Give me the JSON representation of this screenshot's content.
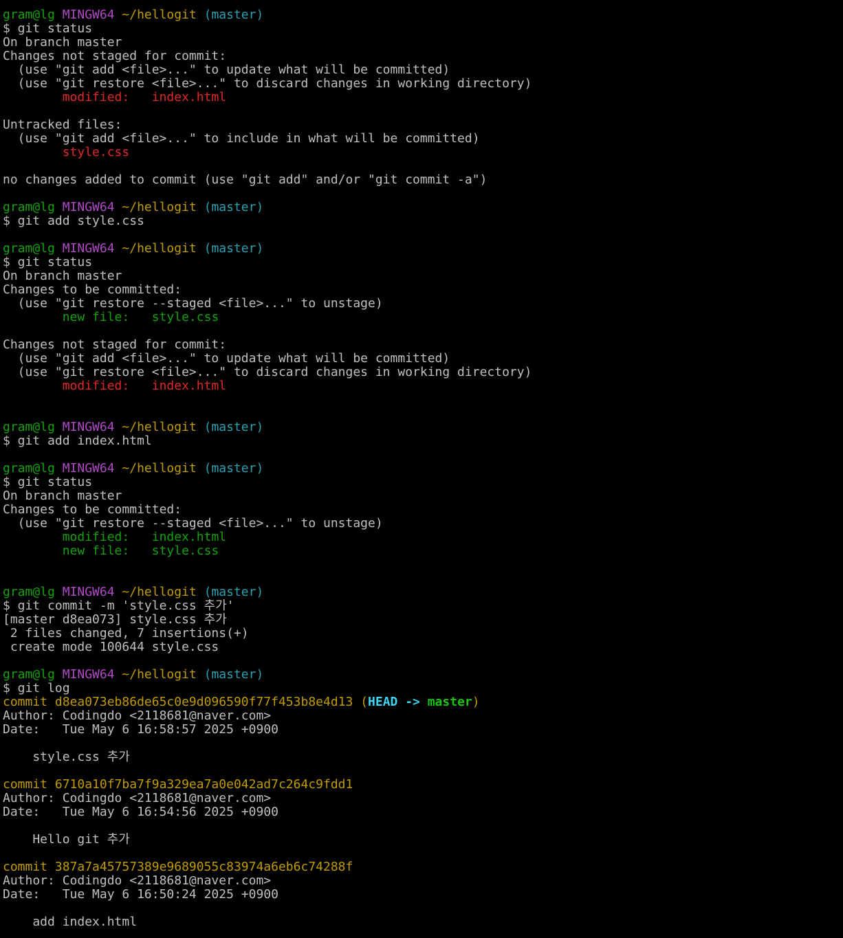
{
  "colors": {
    "background": "#000000",
    "default": "#c0c0c0",
    "green": "#13a10e",
    "magenta": "#b148c6",
    "yellow": "#c19c00",
    "cyan": "#2aa1b3",
    "red": "#e02828",
    "bright_cyan": "#3bd6ef",
    "bright_green": "#16c60c"
  },
  "lines": [
    [
      {
        "t": "gram@lg ",
        "c": "green"
      },
      {
        "t": "MINGW64 ",
        "c": "magenta"
      },
      {
        "t": "~/hellogit ",
        "c": "yellow"
      },
      {
        "t": "(master)",
        "c": "cyan"
      }
    ],
    [
      {
        "t": "$ git status",
        "c": "default"
      }
    ],
    [
      {
        "t": "On branch master",
        "c": "default"
      }
    ],
    [
      {
        "t": "Changes not staged for commit:",
        "c": "default"
      }
    ],
    [
      {
        "t": "  (use \"git add <file>...\" to update what will be committed)",
        "c": "default"
      }
    ],
    [
      {
        "t": "  (use \"git restore <file>...\" to discard changes in working directory)",
        "c": "default"
      }
    ],
    [
      {
        "t": "        ",
        "c": "default"
      },
      {
        "t": "modified:   index.html",
        "c": "red"
      }
    ],
    [],
    [
      {
        "t": "Untracked files:",
        "c": "default"
      }
    ],
    [
      {
        "t": "  (use \"git add <file>...\" to include in what will be committed)",
        "c": "default"
      }
    ],
    [
      {
        "t": "        ",
        "c": "default"
      },
      {
        "t": "style.css",
        "c": "red"
      }
    ],
    [],
    [
      {
        "t": "no changes added to commit (use \"git add\" and/or \"git commit -a\")",
        "c": "default"
      }
    ],
    [],
    [
      {
        "t": "gram@lg ",
        "c": "green"
      },
      {
        "t": "MINGW64 ",
        "c": "magenta"
      },
      {
        "t": "~/hellogit ",
        "c": "yellow"
      },
      {
        "t": "(master)",
        "c": "cyan"
      }
    ],
    [
      {
        "t": "$ git add style.css",
        "c": "default"
      }
    ],
    [],
    [
      {
        "t": "gram@lg ",
        "c": "green"
      },
      {
        "t": "MINGW64 ",
        "c": "magenta"
      },
      {
        "t": "~/hellogit ",
        "c": "yellow"
      },
      {
        "t": "(master)",
        "c": "cyan"
      }
    ],
    [
      {
        "t": "$ git status",
        "c": "default"
      }
    ],
    [
      {
        "t": "On branch master",
        "c": "default"
      }
    ],
    [
      {
        "t": "Changes to be committed:",
        "c": "default"
      }
    ],
    [
      {
        "t": "  (use \"git restore --staged <file>...\" to unstage)",
        "c": "default"
      }
    ],
    [
      {
        "t": "        ",
        "c": "default"
      },
      {
        "t": "new file:   style.css",
        "c": "green"
      }
    ],
    [],
    [
      {
        "t": "Changes not staged for commit:",
        "c": "default"
      }
    ],
    [
      {
        "t": "  (use \"git add <file>...\" to update what will be committed)",
        "c": "default"
      }
    ],
    [
      {
        "t": "  (use \"git restore <file>...\" to discard changes in working directory)",
        "c": "default"
      }
    ],
    [
      {
        "t": "        ",
        "c": "default"
      },
      {
        "t": "modified:   index.html",
        "c": "red"
      }
    ],
    [],
    [],
    [
      {
        "t": "gram@lg ",
        "c": "green"
      },
      {
        "t": "MINGW64 ",
        "c": "magenta"
      },
      {
        "t": "~/hellogit ",
        "c": "yellow"
      },
      {
        "t": "(master)",
        "c": "cyan"
      }
    ],
    [
      {
        "t": "$ git add index.html",
        "c": "default"
      }
    ],
    [],
    [
      {
        "t": "gram@lg ",
        "c": "green"
      },
      {
        "t": "MINGW64 ",
        "c": "magenta"
      },
      {
        "t": "~/hellogit ",
        "c": "yellow"
      },
      {
        "t": "(master)",
        "c": "cyan"
      }
    ],
    [
      {
        "t": "$ git status",
        "c": "default"
      }
    ],
    [
      {
        "t": "On branch master",
        "c": "default"
      }
    ],
    [
      {
        "t": "Changes to be committed:",
        "c": "default"
      }
    ],
    [
      {
        "t": "  (use \"git restore --staged <file>...\" to unstage)",
        "c": "default"
      }
    ],
    [
      {
        "t": "        ",
        "c": "default"
      },
      {
        "t": "modified:   index.html",
        "c": "green"
      }
    ],
    [
      {
        "t": "        ",
        "c": "default"
      },
      {
        "t": "new file:   style.css",
        "c": "green"
      }
    ],
    [],
    [],
    [
      {
        "t": "gram@lg ",
        "c": "green"
      },
      {
        "t": "MINGW64 ",
        "c": "magenta"
      },
      {
        "t": "~/hellogit ",
        "c": "yellow"
      },
      {
        "t": "(master)",
        "c": "cyan"
      }
    ],
    [
      {
        "t": "$ git commit -m 'style.css 추가'",
        "c": "default"
      }
    ],
    [
      {
        "t": "[master d8ea073] style.css 추가",
        "c": "default"
      }
    ],
    [
      {
        "t": " 2 files changed, 7 insertions(+)",
        "c": "default"
      }
    ],
    [
      {
        "t": " create mode 100644 style.css",
        "c": "default"
      }
    ],
    [],
    [
      {
        "t": "gram@lg ",
        "c": "green"
      },
      {
        "t": "MINGW64 ",
        "c": "magenta"
      },
      {
        "t": "~/hellogit ",
        "c": "yellow"
      },
      {
        "t": "(master)",
        "c": "cyan"
      }
    ],
    [
      {
        "t": "$ git log",
        "c": "default"
      }
    ],
    [
      {
        "t": "commit d8ea073eb86de65c0e9d096590f77f453b8e4d13 ",
        "c": "yellow"
      },
      {
        "t": "(",
        "c": "yellow"
      },
      {
        "t": "HEAD -> ",
        "c": "bright_cyan"
      },
      {
        "t": "master",
        "c": "bright_green"
      },
      {
        "t": ")",
        "c": "yellow"
      }
    ],
    [
      {
        "t": "Author: Codingdo <2118681@naver.com>",
        "c": "default"
      }
    ],
    [
      {
        "t": "Date:   Tue May 6 16:58:57 2025 +0900",
        "c": "default"
      }
    ],
    [],
    [
      {
        "t": "    style.css 추가",
        "c": "default"
      }
    ],
    [],
    [
      {
        "t": "commit 6710a10f7ba7f9a329ea7a0e042ad7c264c9fdd1",
        "c": "yellow"
      }
    ],
    [
      {
        "t": "Author: Codingdo <2118681@naver.com>",
        "c": "default"
      }
    ],
    [
      {
        "t": "Date:   Tue May 6 16:54:56 2025 +0900",
        "c": "default"
      }
    ],
    [],
    [
      {
        "t": "    Hello git 추가",
        "c": "default"
      }
    ],
    [],
    [
      {
        "t": "commit 387a7a45757389e9689055c83974a6eb6c74288f",
        "c": "yellow"
      }
    ],
    [
      {
        "t": "Author: Codingdo <2118681@naver.com>",
        "c": "default"
      }
    ],
    [
      {
        "t": "Date:   Tue May 6 16:50:24 2025 +0900",
        "c": "default"
      }
    ],
    [],
    [
      {
        "t": "    add index.html",
        "c": "default"
      }
    ]
  ]
}
